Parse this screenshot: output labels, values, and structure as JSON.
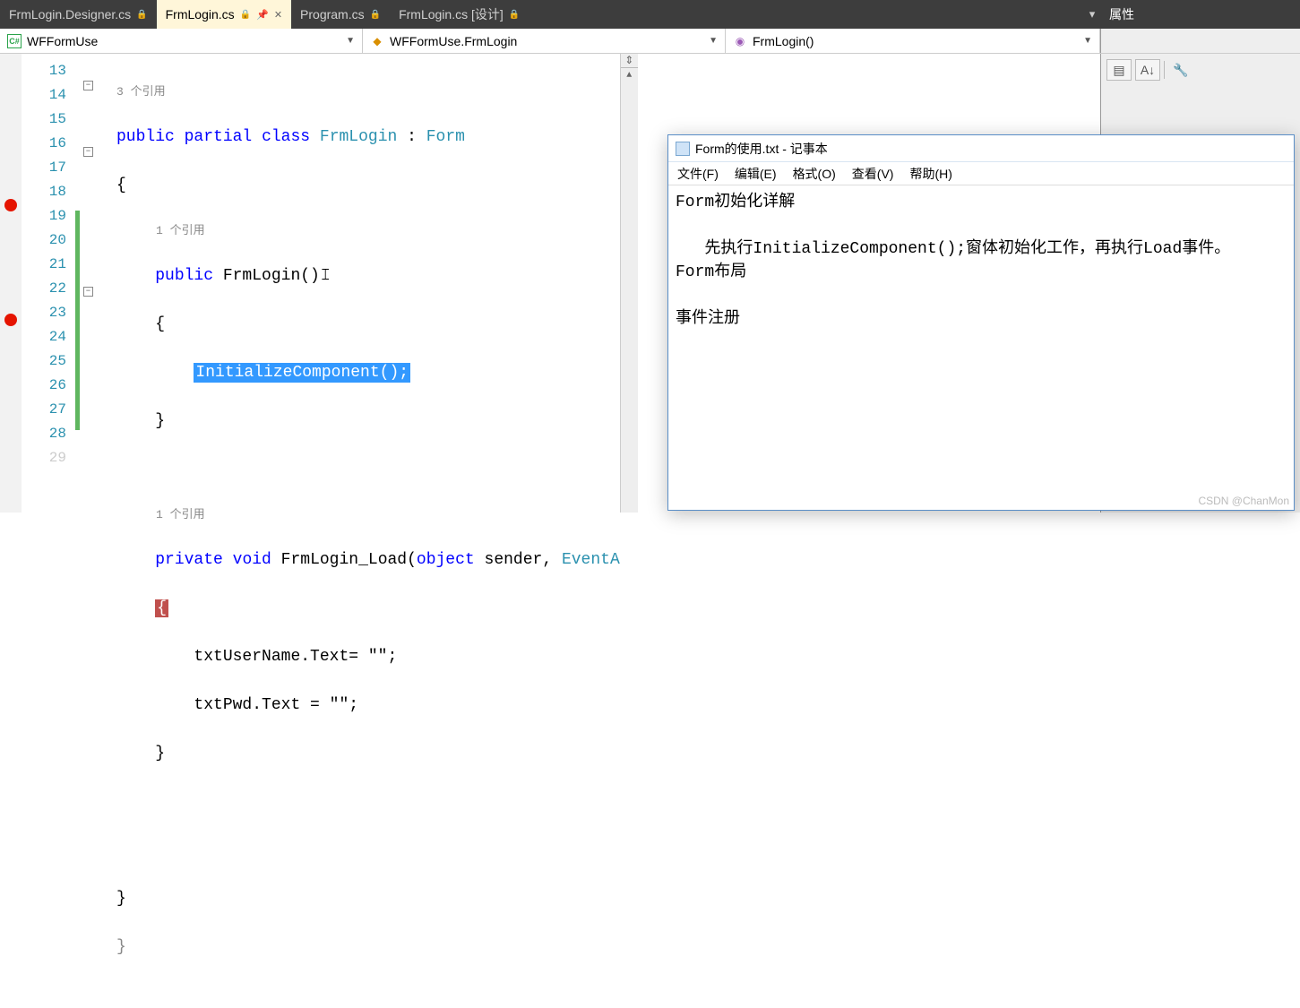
{
  "tabs": [
    {
      "label": "FrmLogin.Designer.cs",
      "active": false,
      "lock": true
    },
    {
      "label": "FrmLogin.cs",
      "active": true,
      "lock": true,
      "pinned": true
    },
    {
      "label": "Program.cs",
      "active": false,
      "lock": true
    },
    {
      "label": "FrmLogin.cs [设计]",
      "active": false,
      "lock": true
    }
  ],
  "properties_label": "属性",
  "nav": {
    "project": "WFFormUse",
    "class": "WFFormUse.FrmLogin",
    "member": "FrmLogin()"
  },
  "gutter": {
    "start": 13,
    "end": 29
  },
  "breakpoints": [
    17,
    21
  ],
  "change_range": [
    19,
    27
  ],
  "fold_lines": [
    13,
    15,
    20
  ],
  "refs": {
    "r1": "3 个引用",
    "r2": "1 个引用",
    "r3": "1 个引用"
  },
  "code": {
    "l13a": "public",
    "l13b": "partial",
    "l13c": "class",
    "l13d": "FrmLogin",
    "l13e": " : ",
    "l13f": "Form",
    "l14": "{",
    "l15a": "public",
    "l15b": " FrmLogin()",
    "l16": "{",
    "l17": "InitializeComponent();",
    "l18": "}",
    "l20a": "private",
    "l20b": "void",
    "l20c": " FrmLogin_Load(",
    "l20d": "object",
    "l20e": " sender, ",
    "l20f": "EventA",
    "l21": "{",
    "l22": "txtUserName.Text= \"\";",
    "l23": "txtPwd.Text = \"\";",
    "l24": "}",
    "l27": "}",
    "l28": "}"
  },
  "notepad": {
    "title": "Form的使用.txt - 记事本",
    "menu": {
      "file": "文件(F)",
      "edit": "编辑(E)",
      "format": "格式(O)",
      "view": "查看(V)",
      "help": "帮助(H)"
    },
    "body_l1": "Form初始化详解",
    "body_l2": "",
    "body_l3": "   先执行InitializeComponent();窗体初始化工作，再执行Load事件。",
    "body_l4": "Form布局",
    "body_l5": "",
    "body_l6": "事件注册"
  },
  "watermark": "CSDN @ChanMon"
}
